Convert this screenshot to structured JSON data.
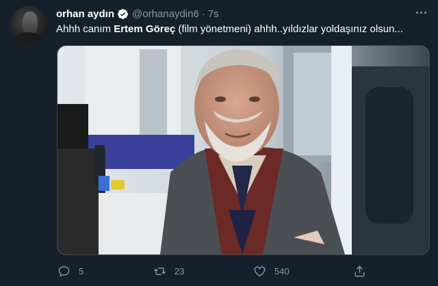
{
  "tweet": {
    "author_name": "orhan aydın",
    "handle": "@orhanaydin6",
    "separator": "·",
    "time": "7s",
    "text_before": "Ahhh canım ",
    "text_bold": "Ertem Göreç",
    "text_after": " (film yönetmeni) ahhh..yıldızlar yoldaşınız olsun..."
  },
  "actions": {
    "reply_count": "5",
    "retweet_count": "23",
    "like_count": "540"
  },
  "colors": {
    "background": "#15202b",
    "secondary_text": "#8899a6",
    "verified_blue": "#1da1f2",
    "border": "#38444d"
  }
}
